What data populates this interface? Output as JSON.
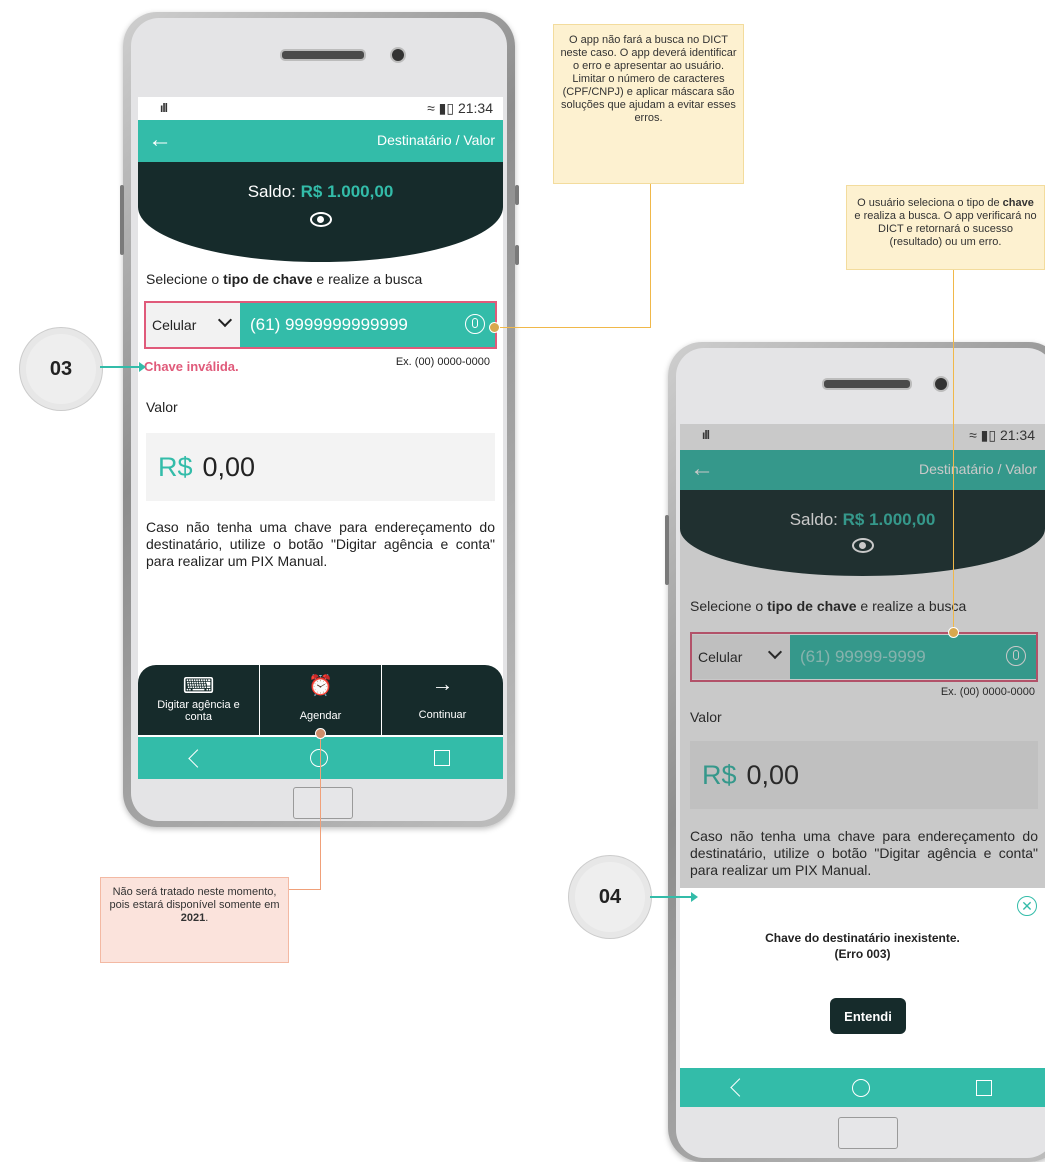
{
  "phone1": {
    "status": {
      "signal": "ıll",
      "icons": "≈ ▮▯",
      "time": "21:34"
    },
    "appbar": {
      "back": "←",
      "title": "Destinatário / Valor"
    },
    "saldo": {
      "label": "Saldo: ",
      "value": "R$ 1.000,00"
    },
    "select_prompt": {
      "pre": "Selecione o ",
      "bold": "tipo de chave",
      "post": " e realize a busca"
    },
    "key_type": "Celular",
    "key_value": "(61) 9999999999999",
    "error": "Chave inválida.",
    "example": "Ex. (00) 0000-0000",
    "valor_label": "Valor",
    "currency": "R$",
    "amount": "0,00",
    "info": "Caso não tenha uma chave para endereçamento do destinatário, utilize o botão \"Digitar agência e conta\" para realizar um PIX Manual.",
    "actions": [
      {
        "icon": "⌨",
        "label": "Digitar agência e conta"
      },
      {
        "icon": "⏰",
        "label": "Agendar"
      },
      {
        "icon": "→",
        "label": "Continuar"
      }
    ]
  },
  "phone2": {
    "status": {
      "signal": "ıll",
      "icons": "≈ ▮▯",
      "time": "21:34"
    },
    "appbar": {
      "back": "←",
      "title": "Destinatário / Valor"
    },
    "saldo": {
      "label": "Saldo: ",
      "value": "R$ 1.000,00"
    },
    "select_prompt": {
      "pre": "Selecione o ",
      "bold": "tipo de chave",
      "post": " e realize a busca"
    },
    "key_type": "Celular",
    "key_placeholder": "(61) 99999-9999",
    "example": "Ex. (00) 0000-0000",
    "valor_label": "Valor",
    "currency": "R$",
    "amount": "0,00",
    "info": "Caso não tenha uma chave para endereçamento do destinatário, utilize o botão \"Digitar agência e conta\" para realizar um PIX Manual.",
    "modal": {
      "line1": "Chave do destinatário inexistente.",
      "line2": "(Erro 003)",
      "button": "Entendi",
      "close": "✕"
    }
  },
  "notes": {
    "top": "O app não fará a busca no DICT neste caso. O app deverá identificar o erro e apresentar ao usuário. Limitar o número de caracteres (CPF/CNPJ) e aplicar máscara são soluções que ajudam a evitar esses erros.",
    "right": {
      "pre": "O usuário seleciona o tipo de ",
      "bold": "chave",
      "post": " e realiza a busca. O app verificará no DICT e retornará o sucesso (resultado) ou um erro."
    },
    "bottom": {
      "pre": "Não será tratado neste momento, pois estará disponível somente em ",
      "bold": "2021",
      "post": "."
    }
  },
  "badges": {
    "b1": "03",
    "b2": "04"
  },
  "colors": {
    "teal": "#33bca9",
    "dark": "#162b2b",
    "error": "#e05a7a"
  }
}
